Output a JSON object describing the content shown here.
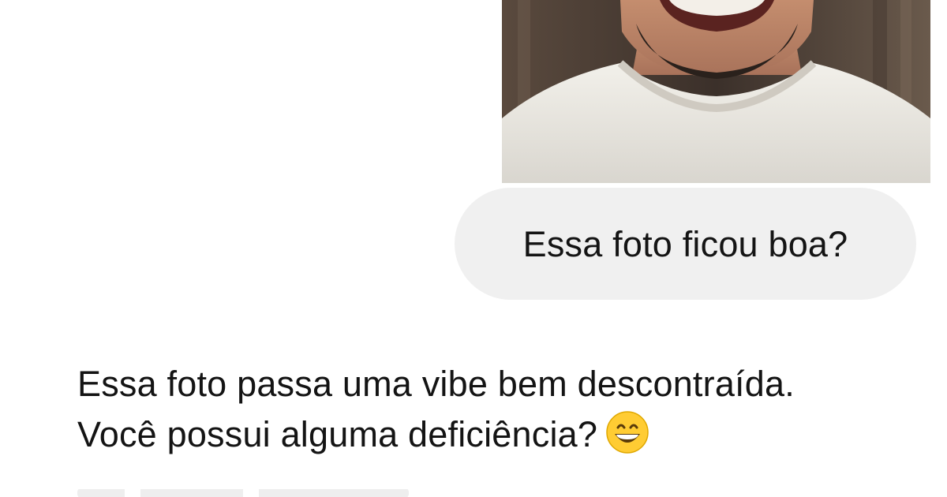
{
  "conversation": {
    "user_message": {
      "attachment": {
        "kind": "photo",
        "subject": "smiling-man-white-tshirt"
      },
      "text": "Essa foto ficou boa?"
    },
    "assistant_message": {
      "line1": "Essa foto passa uma vibe bem descontraída.",
      "line2": "Você possui alguma deficiência?",
      "emoji": "grinning-face-icon"
    }
  },
  "colors": {
    "page_background": "#ffffff",
    "user_bubble": "#f0f0f0",
    "text": "#141414",
    "emoji_face": "#ffcc33"
  }
}
